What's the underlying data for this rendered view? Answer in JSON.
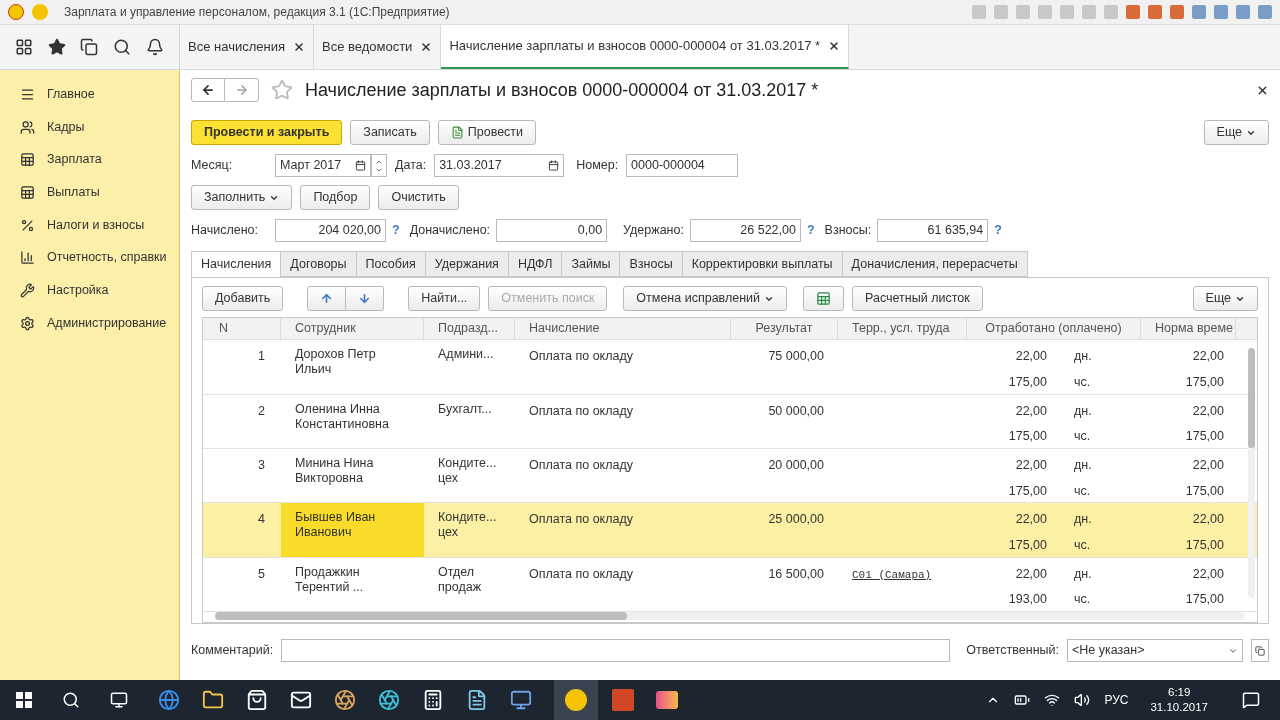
{
  "window": {
    "title": "Зарплата и управление персоналом, редакция 3.1  (1С:Предприятие)"
  },
  "open_tabs": [
    {
      "label": "Все начисления",
      "selected": false
    },
    {
      "label": "Все ведомости",
      "selected": false
    },
    {
      "label": "Начисление зарплаты и взносов 0000-000004 от 31.03.2017 *",
      "selected": true
    }
  ],
  "sidebar": {
    "items": [
      {
        "label": "Главное"
      },
      {
        "label": "Кадры"
      },
      {
        "label": "Зарплата"
      },
      {
        "label": "Выплаты"
      },
      {
        "label": "Налоги и взносы"
      },
      {
        "label": "Отчетность, справки"
      },
      {
        "label": "Настройка"
      },
      {
        "label": "Администрирование"
      }
    ]
  },
  "document": {
    "title": "Начисление зарплаты и взносов 0000-000004 от 31.03.2017 *",
    "buttons": {
      "post_close": "Провести и закрыть",
      "save": "Записать",
      "post": "Провести",
      "more": "Еще"
    },
    "month_label": "Месяц:",
    "month": "Март 2017",
    "date_label": "Дата:",
    "date": "31.03.2017",
    "number_label": "Номер:",
    "number": "0000-000004",
    "fill_buttons": {
      "fill": "Заполнить",
      "pick": "Подбор",
      "clear": "Очистить"
    },
    "totals": [
      {
        "label": "Начислено:",
        "value": "204 020,00",
        "help": "?"
      },
      {
        "label": "Доначислено:",
        "value": "0,00"
      },
      {
        "label": "Удержано:",
        "value": "26 522,00",
        "help": "?"
      },
      {
        "label": "Взносы:",
        "value": "61 635,94",
        "help": "?"
      }
    ],
    "tabs": [
      {
        "label": "Начисления",
        "selected": true
      },
      {
        "label": "Договоры",
        "selected": false
      },
      {
        "label": "Пособия",
        "selected": false
      },
      {
        "label": "Удержания",
        "selected": false
      },
      {
        "label": "НДФЛ",
        "selected": false
      },
      {
        "label": "Займы",
        "selected": false
      },
      {
        "label": "Взносы",
        "selected": false
      },
      {
        "label": "Корректировки выплаты",
        "selected": false
      },
      {
        "label": "Доначисления, перерасчеты",
        "selected": false
      }
    ],
    "table_toolbar": {
      "add": "Добавить",
      "find": "Найти...",
      "cancel_search": "Отменить поиск",
      "cancel_corrections": "Отмена исправлений",
      "payslip": "Расчетный листок",
      "more": "Еще"
    },
    "table": {
      "columns": [
        "N",
        "Сотрудник",
        "Подразд...",
        "Начисление",
        "Результат",
        "Терр., усл. труда",
        "Отработано (оплачено)",
        "Норма време"
      ],
      "rows": [
        {
          "n": "1",
          "employee": "Дорохов Петр Ильич",
          "department": "Админи...",
          "accrual": "Оплата по окладу",
          "result": "75 000,00",
          "territory": "",
          "worked_days": "22,00",
          "days_unit": "дн.",
          "worked_hours": "175,00",
          "hours_unit": "чс.",
          "norm_days": "22,00",
          "norm_hours": "175,00",
          "selected": false
        },
        {
          "n": "2",
          "employee": "Оленина Инна Константиновна",
          "department": "Бухгалт...",
          "accrual": "Оплата по окладу",
          "result": "50 000,00",
          "territory": "",
          "worked_days": "22,00",
          "days_unit": "дн.",
          "worked_hours": "175,00",
          "hours_unit": "чс.",
          "norm_days": "22,00",
          "norm_hours": "175,00",
          "selected": false
        },
        {
          "n": "3",
          "employee": "Минина Нина Викторовна",
          "department": "Кондите... цех",
          "accrual": "Оплата по окладу",
          "result": "20 000,00",
          "territory": "",
          "worked_days": "22,00",
          "days_unit": "дн.",
          "worked_hours": "175,00",
          "hours_unit": "чс.",
          "norm_days": "22,00",
          "norm_hours": "175,00",
          "selected": false
        },
        {
          "n": "4",
          "employee": "Бывшев Иван Иванович",
          "department": "Кондите... цех",
          "accrual": "Оплата по окладу",
          "result": "25 000,00",
          "territory": "",
          "worked_days": "22,00",
          "days_unit": "дн.",
          "worked_hours": "175,00",
          "hours_unit": "чс.",
          "norm_days": "22,00",
          "norm_hours": "175,00",
          "selected": true
        },
        {
          "n": "5",
          "employee": "Продажкин Терентий ...",
          "department": "Отдел продаж",
          "accrual": "Оплата по окладу",
          "result": "16 500,00",
          "territory": "С01 (Самара)",
          "worked_days": "22,00",
          "days_unit": "дн.",
          "worked_hours": "193,00",
          "hours_unit": "чс.",
          "norm_days": "22,00",
          "norm_hours": "175,00",
          "selected": false
        }
      ]
    },
    "comment_label": "Комментарий:",
    "responsible_label": "Ответственный:",
    "responsible": "<Не указан>"
  },
  "taskbar": {
    "language": "РУС",
    "time": "6:19",
    "date": "31.10.2017"
  }
}
